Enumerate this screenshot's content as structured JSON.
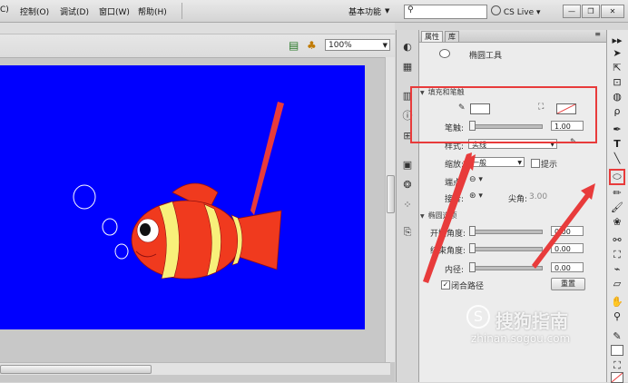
{
  "menubar": {
    "items": [
      "C)",
      "控制(O)",
      "调试(D)",
      "窗口(W)",
      "帮助(H)"
    ],
    "workspace": "基本功能",
    "search_placeholder": "",
    "cs_live": "CS Live"
  },
  "stage": {
    "zoom": "100%",
    "canvas_color": "#0000ff"
  },
  "panel": {
    "tabs": [
      "属性",
      "库"
    ],
    "tool_name": "椭圆工具",
    "fill_stroke_section": "填充和笔触",
    "stroke_label": "笔触:",
    "stroke_value": "1.00",
    "style_label": "样式:",
    "style_value": "实线",
    "scale_label": "缩放:",
    "scale_value": "一般",
    "hint_label": "提示",
    "cap_label": "端点:",
    "join_label": "接合:",
    "miter_label": "尖角:",
    "miter_value": "3.00",
    "ellipse_section": "椭圆选项",
    "start_angle_label": "开始角度:",
    "start_angle_value": "0.00",
    "end_angle_label": "结束角度:",
    "end_angle_value": "0.00",
    "inner_radius_label": "内径:",
    "inner_radius_value": "0.00",
    "close_path_label": "闭合路径",
    "reset_label": "重置"
  },
  "watermark": {
    "brand": "搜狗指南",
    "logo_letter": "S",
    "url": "zhinan.sogou.com"
  },
  "colors": {
    "highlight": "#e83b3b",
    "fish_body": "#f03a1e",
    "fish_stripe": "#f8f07a"
  }
}
